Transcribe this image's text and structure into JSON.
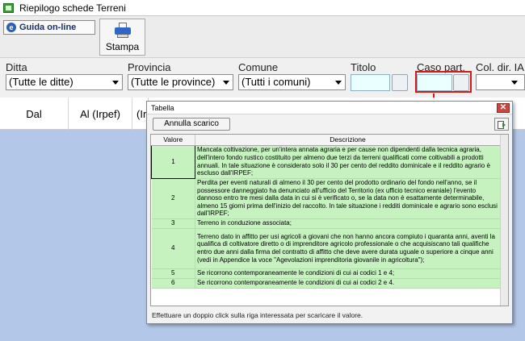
{
  "window": {
    "title": "Riepilogo schede Terreni"
  },
  "toolbar": {
    "guida_label": "Guida on-line",
    "guida_icon": "e-help-icon",
    "stampa_label": "Stampa",
    "stampa_icon": "printer-icon"
  },
  "filters": {
    "ditta": {
      "label": "Ditta",
      "value": "(Tutte le ditte)"
    },
    "provincia": {
      "label": "Provincia",
      "value": "(Tutte le province)"
    },
    "comune": {
      "label": "Comune",
      "value": "(Tutti i comuni)"
    },
    "titolo": {
      "label": "Titolo",
      "value": ""
    },
    "caso_part": {
      "label": "Caso part.",
      "value": ""
    },
    "col_dir": {
      "label": "Col. dir. IA",
      "value": ""
    }
  },
  "grid": {
    "columns": [
      "Dal",
      "Al (Irpef)",
      "(Ir"
    ]
  },
  "dialog": {
    "title": "Tabella",
    "annulla_label": "Annulla scarico",
    "headers": {
      "valore": "Valore",
      "descrizione": "Descrizione"
    },
    "rows": [
      {
        "valore": "1",
        "descrizione": "Mancata coltivazione, per un'intera annata agraria e per cause non dipendenti dalla tecnica agraria, dell'intero fondo rustico costituito per almeno due terzi da terreni qualificati come coltivabili a prodotti annuali. In tale situazione è considerato  solo il 30 per cento del reddito dominicale e il reddito agrario è escluso dall'IRPEF;"
      },
      {
        "valore": "2",
        "descrizione": "Perdita per eventi naturali di almeno il 30 per cento del prodotto ordinario del fondo nell'anno, se il possessore danneggiato ha denunciato all'ufficio del Territorio (ex ufficio tecnico eraniale) l'evento dannoso entro tre mesi dalla data in cui si è verificato o, se la data non è esattamente determinabile, almeno 15 giorni prima dell'inizio del raccolto. In tale situazione i redditi dominicale e agrario sono esclusi dall'IRPEF;"
      },
      {
        "valore": "3",
        "descrizione": "Terreno in conduzione associata;"
      },
      {
        "valore": "4",
        "descrizione": "Terreno dato in affitto per usi agricoli a giovani che non hanno ancora compiuto i quaranta anni, aventi la qualifica di coltivatore diretto o di imprenditore agricolo professionale o che acquisiscano tali qualifiche entro due anni dalla firma del contratto di affitto che deve avere durata uguale o superiore a cinque anni (vedi in Appendice la voce \"Agevolazioni imprenditoria giovanile in agricoltura\");"
      },
      {
        "valore": "5",
        "descrizione": "Se ricorrono contemporaneamente le condizioni di cui ai codici 1 e 4;"
      },
      {
        "valore": "6",
        "descrizione": "Se ricorrono contemporaneamente le condizioni di cui ai codici 2 e 4."
      }
    ],
    "hint": "Effettuare un doppio click sulla riga interessata per scaricare il valore."
  }
}
